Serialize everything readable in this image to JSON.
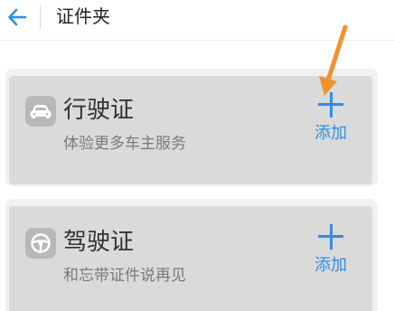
{
  "header": {
    "title": "证件夹"
  },
  "cards": [
    {
      "title": "行驶证",
      "subtitle": "体验更多车主服务",
      "add_label": "添加",
      "icon": "car-icon"
    },
    {
      "title": "驾驶证",
      "subtitle": "和忘带证件说再见",
      "add_label": "添加",
      "icon": "steering-wheel-icon"
    }
  ],
  "colors": {
    "accent": "#2f8ee5",
    "annotation_arrow": "#f0922e",
    "card_bg": "#dadada"
  }
}
